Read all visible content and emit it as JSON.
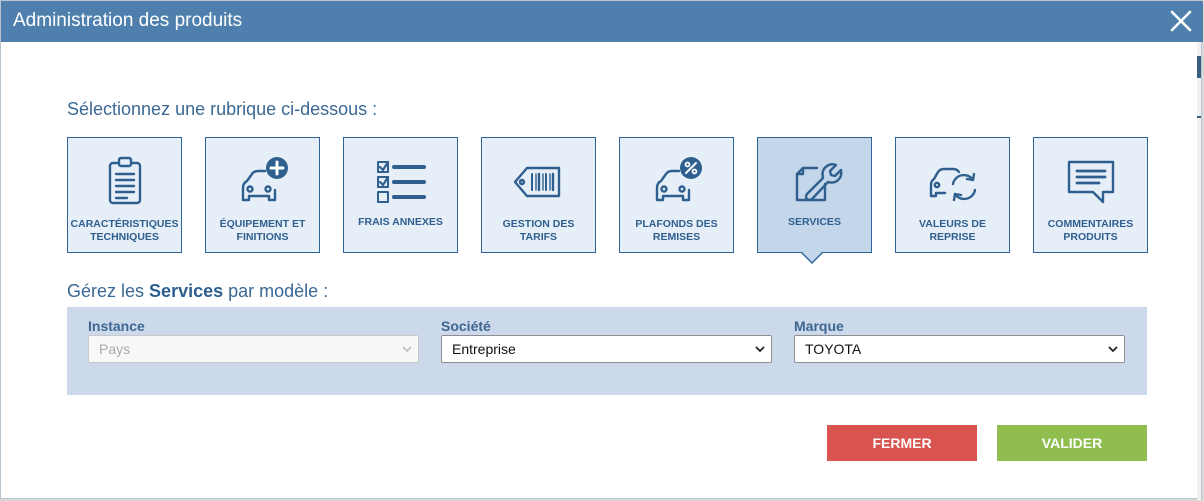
{
  "modal": {
    "title": "Administration des produits"
  },
  "prompt": "Sélectionnez une rubrique ci-dessous :",
  "tiles": [
    {
      "label": "CARACTÉRISTIQUES TECHNIQUES",
      "icon": "clipboard-icon",
      "active": false
    },
    {
      "label": "ÉQUIPEMENT ET FINITIONS",
      "icon": "car-plus-icon",
      "active": false
    },
    {
      "label": "FRAIS ANNEXES",
      "icon": "checklist-icon",
      "active": false
    },
    {
      "label": "GESTION DES TARIFS",
      "icon": "price-tag-icon",
      "active": false
    },
    {
      "label": "PLAFONDS DES REMISES",
      "icon": "car-percent-icon",
      "active": false
    },
    {
      "label": "SERVICES",
      "icon": "wrench-icon",
      "active": true
    },
    {
      "label": "VALEURS DE REPRISE",
      "icon": "car-cycle-icon",
      "active": false
    },
    {
      "label": "COMMENTAIRES PRODUITS",
      "icon": "comment-icon",
      "active": false
    }
  ],
  "manage": {
    "prefix": "Gérez les",
    "highlight": "Services",
    "suffix": "par modèle :"
  },
  "filters": {
    "instance": {
      "label": "Instance",
      "value": "Pays",
      "disabled": true
    },
    "societe": {
      "label": "Société",
      "value": "Entreprise",
      "disabled": false
    },
    "marque": {
      "label": "Marque",
      "value": "TOYOTA",
      "disabled": false
    }
  },
  "buttons": {
    "close_label": "FERMER",
    "ok_label": "VALIDER"
  },
  "colors": {
    "header": "#4f80ad",
    "tile_border": "#2f6496",
    "tile_bg": "#e6eef7",
    "tile_active_bg": "#c4d6ea",
    "panel_bg": "#ccd9ea",
    "close_button": "#d9534f",
    "ok_button": "#8fbe4f"
  }
}
